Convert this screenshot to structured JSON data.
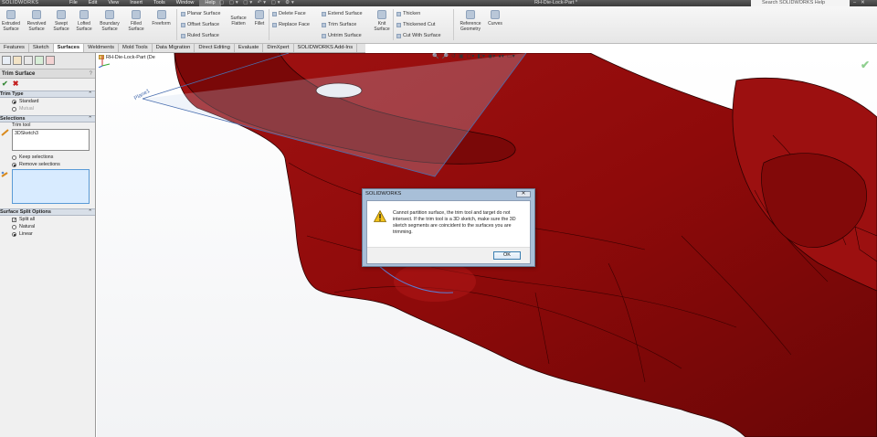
{
  "app": {
    "logo": "SOLIDWORKS",
    "document_title": "RH-Die-Lock-Part *",
    "search_placeholder": "Search SOLIDWORKS Help",
    "menu": [
      "File",
      "Edit",
      "View",
      "Insert",
      "Tools",
      "Window",
      "Help"
    ],
    "active_menu": "Help"
  },
  "ribbon": {
    "big_buttons": [
      {
        "label1": "Extruded",
        "label2": "Surface"
      },
      {
        "label1": "Revolved",
        "label2": "Surface"
      },
      {
        "label1": "Swept",
        "label2": "Surface"
      },
      {
        "label1": "Lofted",
        "label2": "Surface"
      },
      {
        "label1": "Boundary",
        "label2": "Surface"
      },
      {
        "label1": "Filled",
        "label2": "Surface"
      },
      {
        "label1": "Freeform",
        "label2": ""
      }
    ],
    "col1": [
      "Planar Surface",
      "Offset Surface",
      "Ruled Surface"
    ],
    "surface_flatten": {
      "label1": "Surface",
      "label2": "Flatten"
    },
    "fillet": "Fillet",
    "col2": [
      "Delete Face",
      "Replace Face",
      ""
    ],
    "col3": [
      "Extend Surface",
      "Trim Surface",
      "Untrim Surface"
    ],
    "knit": {
      "label1": "Knit",
      "label2": "Surface"
    },
    "col4": [
      "Thicken",
      "Thickened Cut",
      "Cut With Surface"
    ],
    "ref_geom": {
      "label1": "Reference",
      "label2": "Geometry"
    },
    "curves": "Curves"
  },
  "tabs": [
    {
      "label": "Features",
      "active": false
    },
    {
      "label": "Sketch",
      "active": false
    },
    {
      "label": "Surfaces",
      "active": true
    },
    {
      "label": "Weldments",
      "active": false
    },
    {
      "label": "Mold Tools",
      "active": false
    },
    {
      "label": "Data Migration",
      "active": false
    },
    {
      "label": "Direct Editing",
      "active": false
    },
    {
      "label": "Evaluate",
      "active": false
    },
    {
      "label": "DimXpert",
      "active": false
    },
    {
      "label": "SOLIDWORKS Add-Ins",
      "active": false
    }
  ],
  "property_manager": {
    "title": "Trim Surface",
    "help": "?",
    "trim_type": {
      "title": "Trim Type",
      "options": [
        {
          "label": "Standard",
          "selected": true,
          "enabled": true
        },
        {
          "label": "Mutual",
          "selected": false,
          "enabled": false
        }
      ]
    },
    "selections": {
      "title": "Selections",
      "trim_tool_label": "Trim tool",
      "trim_tool_value": "3DSketch3",
      "options": [
        {
          "label": "Keep selections",
          "selected": false
        },
        {
          "label": "Remove selections",
          "selected": true
        }
      ]
    },
    "split_options": {
      "title": "Surface Split Options",
      "split_all": {
        "label": "Split all",
        "checked": true
      },
      "options": [
        {
          "label": "Natural",
          "selected": false
        },
        {
          "label": "Linear",
          "selected": true
        }
      ]
    }
  },
  "viewport": {
    "tree_root": "RH-Die-Lock-Part (De",
    "plane_label": "Plane1",
    "model_color": "#8e0a0a",
    "model_shade": "#5c0505",
    "model_highlight": "#b01818"
  },
  "dialog": {
    "title": "SOLIDWORKS",
    "close": "✕",
    "message": "Cannot partition surface, the trim tool and target do not intersect. If the trim tool is a 3D sketch, make sure the 3D sketch segments are coincident to the surfaces you are trimming.",
    "ok_label": "OK"
  }
}
